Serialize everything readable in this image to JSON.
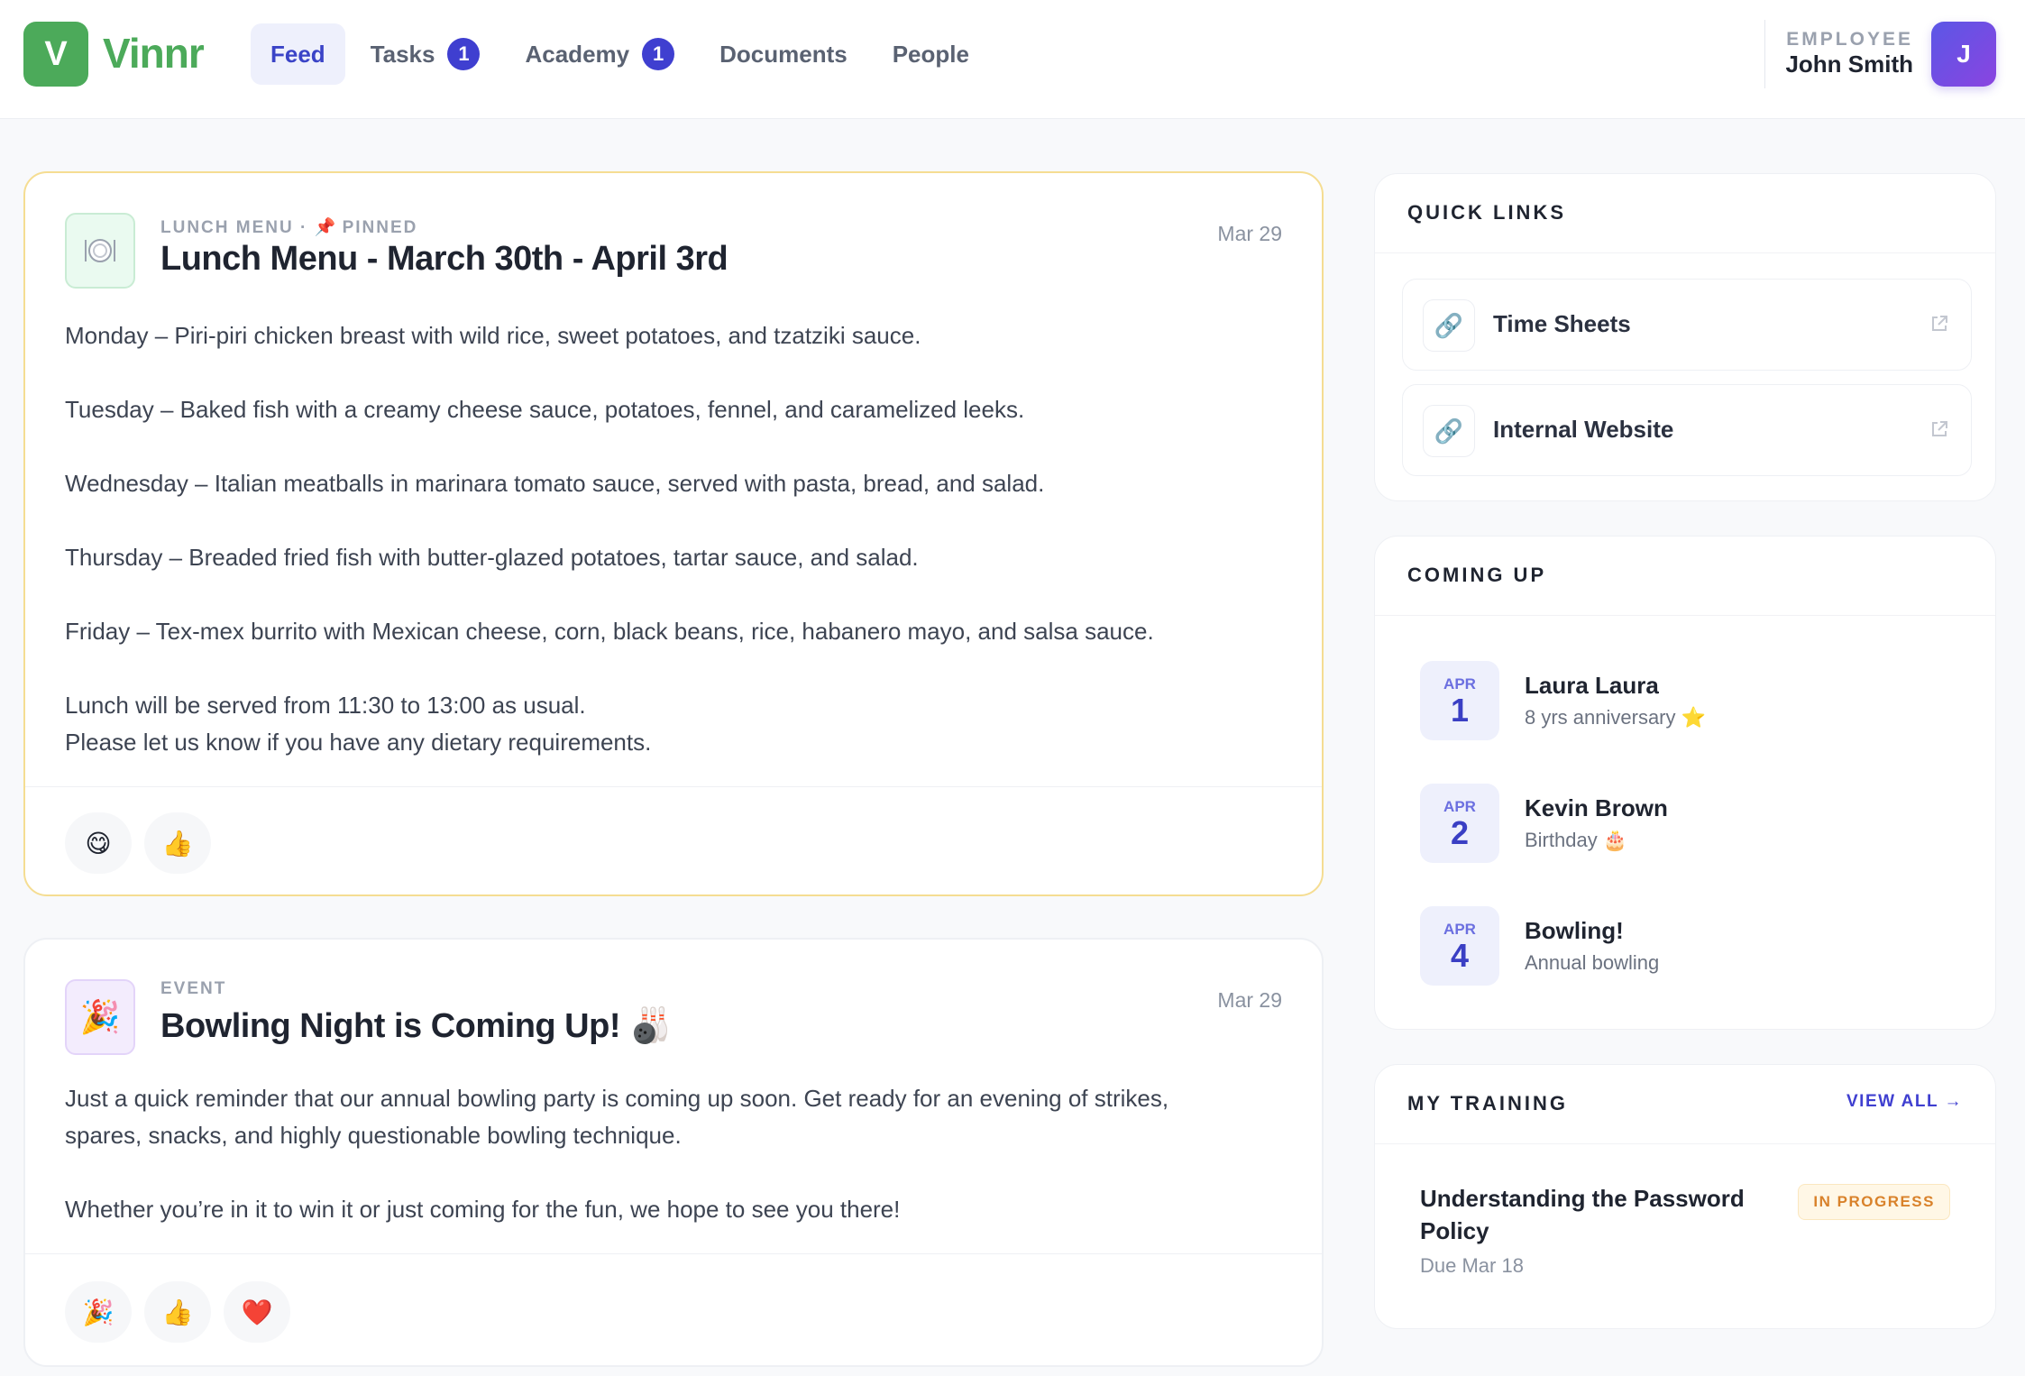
{
  "app": {
    "logo_letter": "V",
    "name": "Vinnr",
    "brand_color": "#4caa5a",
    "accent_color": "#3f3fd0"
  },
  "nav": {
    "items": [
      {
        "label": "Feed",
        "active": true
      },
      {
        "label": "Tasks",
        "badge": "1"
      },
      {
        "label": "Academy",
        "badge": "1"
      },
      {
        "label": "Documents"
      },
      {
        "label": "People"
      }
    ]
  },
  "user": {
    "role": "EMPLOYEE",
    "name": "John Smith",
    "avatar_letter": "J"
  },
  "feed": {
    "posts": [
      {
        "icon": "plate-cutlery-icon",
        "category": "LUNCH MENU",
        "separator": "·",
        "pinned_label": "PINNED",
        "title": "Lunch Menu - March 30th - April 3rd",
        "date": "Mar 29",
        "lines": [
          "Monday – Piri-piri chicken breast with wild rice, sweet potatoes, and tzatziki sauce.",
          "Tuesday – Baked fish with a creamy cheese sauce, potatoes, fennel, and caramelized leeks.",
          "Wednesday – Italian meatballs in marinara tomato sauce, served with pasta, bread, and salad.",
          "Thursday – Breaded fried fish with butter-glazed potatoes, tartar sauce, and salad.",
          "Friday – Tex-mex burrito with Mexican cheese, corn, black beans, rice, habanero mayo, and salsa sauce.",
          "Lunch will be served from 11:30 to 13:00 as usual.",
          "Please let us know if you have any dietary requirements."
        ],
        "reactions": [
          "😋",
          "👍"
        ]
      },
      {
        "icon": "party-popper-icon",
        "category": "EVENT",
        "title": "Bowling Night is Coming Up! 🎳",
        "date": "Mar 29",
        "lines": [
          "Just a quick reminder that our annual bowling party is coming up soon. Get ready for an evening of strikes,",
          "spares, snacks, and highly questionable bowling technique.",
          "Whether you’re in it to win it or just coming for the fun, we hope to see you there!"
        ],
        "reactions": [
          "🎉",
          "👍",
          "❤️"
        ]
      }
    ]
  },
  "quick_links": {
    "title": "QUICK LINKS",
    "items": [
      {
        "label": "Time Sheets",
        "icon": "link-icon"
      },
      {
        "label": "Internal Website",
        "icon": "link-icon"
      }
    ]
  },
  "coming_up": {
    "title": "COMING UP",
    "events": [
      {
        "month": "APR",
        "day": "1",
        "name": "Laura Laura",
        "detail": "8 yrs anniversary ⭐"
      },
      {
        "month": "APR",
        "day": "2",
        "name": "Kevin Brown",
        "detail": "Birthday 🎂"
      },
      {
        "month": "APR",
        "day": "4",
        "name": "Bowling!",
        "detail": "Annual bowling"
      }
    ]
  },
  "training": {
    "title": "MY TRAINING",
    "view_all": "VIEW ALL →",
    "course": {
      "title": "Understanding the Password Policy",
      "due": "Due Mar 18",
      "status": "IN PROGRESS",
      "status_color": "#d9822b"
    }
  }
}
